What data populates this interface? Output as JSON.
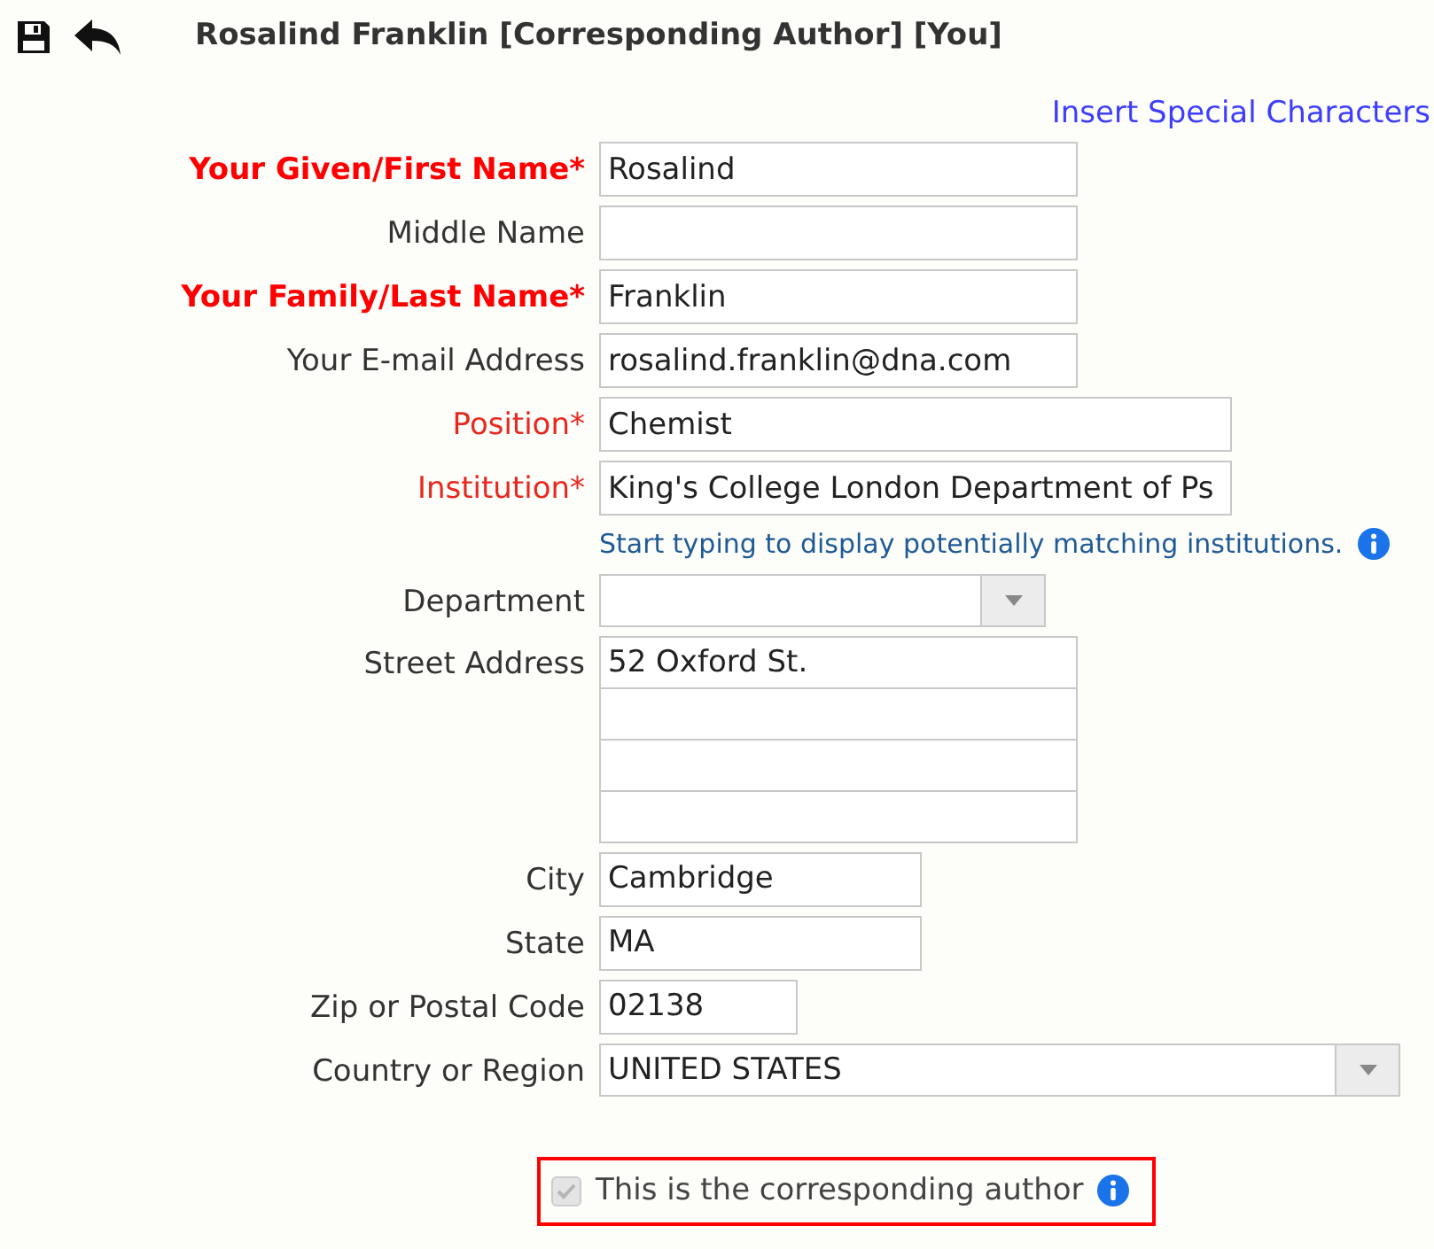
{
  "header": {
    "title": "Rosalind Franklin [Corresponding Author] [You]"
  },
  "special_characters_link": "Insert Special Characters",
  "fields": [
    {
      "label": "Your Given/First Name*",
      "required": true,
      "emphasized": true,
      "kind": "text",
      "value": "Rosalind"
    },
    {
      "label": "Middle Name",
      "required": false,
      "emphasized": false,
      "kind": "text"
    },
    {
      "label": "Your Family/Last Name*",
      "required": true,
      "emphasized": true,
      "kind": "text",
      "value": "Franklin"
    },
    {
      "label": "Your E-mail Address",
      "required": false,
      "emphasized": false,
      "kind": "text",
      "value": "rosalind.franklin@dna.com"
    },
    {
      "label": "Position*",
      "required": true,
      "emphasized": false,
      "kind": "text",
      "value": "Chemist"
    },
    {
      "label": "Institution*",
      "required": true,
      "emphasized": false,
      "kind": "text",
      "value": "King's College London Department of Ps",
      "hint": "Start typing to display potentially matching institutions."
    },
    {
      "label": "Department",
      "required": false,
      "emphasized": false,
      "kind": "select"
    },
    {
      "label": "Street Address",
      "required": false,
      "emphasized": false,
      "kind": "lines",
      "value": "52 Oxford St."
    },
    {
      "label": "City",
      "required": false,
      "emphasized": false,
      "kind": "text",
      "value": "Cambridge"
    },
    {
      "label": "State",
      "required": false,
      "emphasized": false,
      "kind": "text",
      "value": "MA"
    },
    {
      "label": "Zip or Postal Code",
      "required": false,
      "emphasized": false,
      "kind": "text",
      "value": "02138"
    },
    {
      "label": "Country or Region",
      "required": false,
      "emphasized": false,
      "kind": "select",
      "value": "UNITED STATES"
    }
  ],
  "corresponding": {
    "label": "This is the corresponding author",
    "checked": true,
    "disabled": true
  }
}
